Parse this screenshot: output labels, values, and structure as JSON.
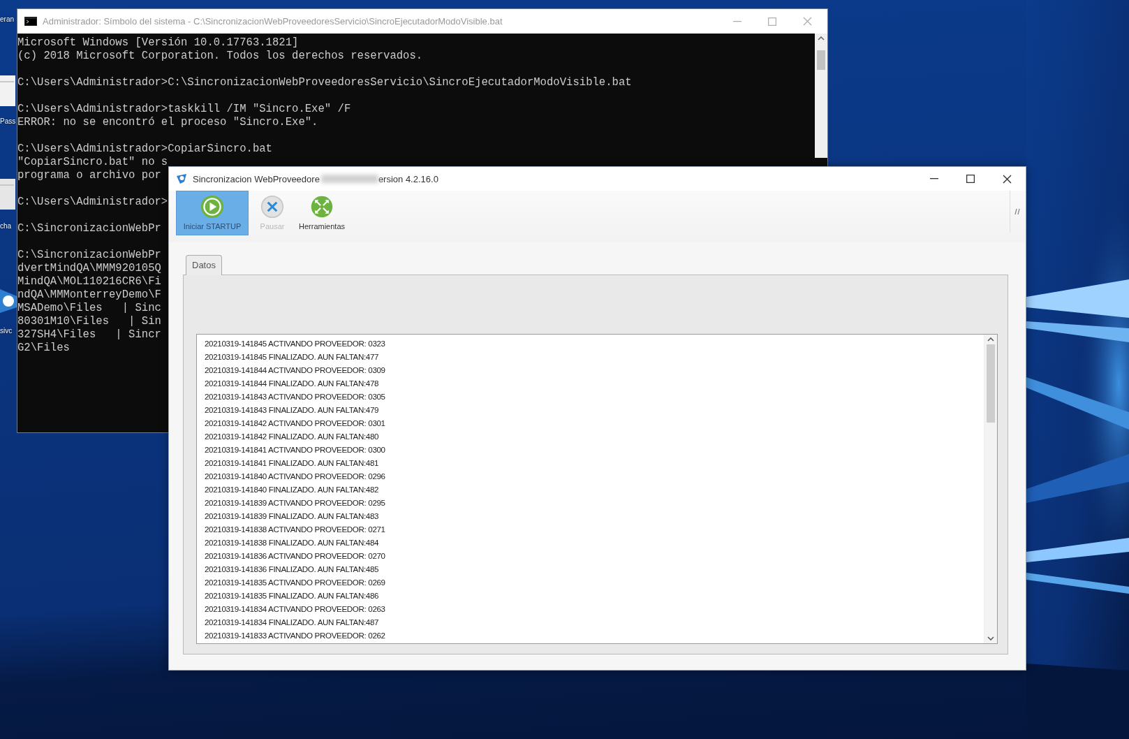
{
  "desktop": {
    "icon_labels": [
      "eran",
      "Pass",
      "cha",
      "sivc"
    ]
  },
  "console": {
    "title": "Administrador: Símbolo del sistema - C:\\SincronizacionWebProveedoresServicio\\SincroEjecutadorModoVisible.bat",
    "blocks": [
      [
        "Microsoft Windows [Versión 10.0.17763.1821]",
        "(c) 2018 Microsoft Corporation. Todos los derechos reservados."
      ],
      [
        "C:\\Users\\Administrador>C:\\SincronizacionWebProveedoresServicio\\SincroEjecutadorModoVisible.bat"
      ],
      [
        "C:\\Users\\Administrador>taskkill /IM \"Sincro.Exe\" /F",
        "ERROR: no se encontró el proceso \"Sincro.Exe\"."
      ],
      [
        "C:\\Users\\Administrador>CopiarSincro.bat",
        "\"CopiarSincro.bat\" no s",
        "programa o archivo por"
      ],
      [
        "C:\\Users\\Administrador>"
      ],
      [
        "C:\\SincronizacionWebPr"
      ],
      [
        "C:\\SincronizacionWebPr",
        "dvertMindQA\\MMM920105Q",
        "MindQA\\MOL110216CR6\\Fi",
        "ndQA\\MMMonterreyDemo\\F",
        "MSADemo\\Files   | Sinc",
        "80301M10\\Files   | Sin",
        "327SH4\\Files   | Sincr",
        "G2\\Files"
      ]
    ]
  },
  "app": {
    "title_start": "Sincronizacion WebProveedore",
    "title_end": "ersion 4.2.16.0",
    "toolbar": [
      {
        "label": "Iniciar STARTUP",
        "kind": "play",
        "selected": true,
        "disabled": false
      },
      {
        "label": "Pausar",
        "kind": "stop",
        "selected": false,
        "disabled": true
      },
      {
        "label": "Herramientas",
        "kind": "tools",
        "selected": false,
        "disabled": false
      }
    ],
    "tabs": [
      {
        "label": "Datos",
        "selected": true
      }
    ],
    "log": [
      "20210319-141845 ACTIVANDO PROVEEDOR: 0323",
      "20210319-141845 FINALIZADO. AUN FALTAN:477",
      "20210319-141844 ACTIVANDO PROVEEDOR: 0309",
      "20210319-141844 FINALIZADO. AUN FALTAN:478",
      "20210319-141843 ACTIVANDO PROVEEDOR: 0305",
      "20210319-141843 FINALIZADO. AUN FALTAN:479",
      "20210319-141842 ACTIVANDO PROVEEDOR: 0301",
      "20210319-141842 FINALIZADO. AUN FALTAN:480",
      "20210319-141841 ACTIVANDO PROVEEDOR: 0300",
      "20210319-141841 FINALIZADO. AUN FALTAN:481",
      "20210319-141840 ACTIVANDO PROVEEDOR: 0296",
      "20210319-141840 FINALIZADO. AUN FALTAN:482",
      "20210319-141839 ACTIVANDO PROVEEDOR: 0295",
      "20210319-141839 FINALIZADO. AUN FALTAN:483",
      "20210319-141838 ACTIVANDO PROVEEDOR: 0271",
      "20210319-141838 FINALIZADO. AUN FALTAN:484",
      "20210319-141836 ACTIVANDO PROVEEDOR: 0270",
      "20210319-141836 FINALIZADO. AUN FALTAN:485",
      "20210319-141835 ACTIVANDO PROVEEDOR: 0269",
      "20210319-141835 FINALIZADO. AUN FALTAN:486",
      "20210319-141834 ACTIVANDO PROVEEDOR: 0263",
      "20210319-141834 FINALIZADO. AUN FALTAN:487",
      "20210319-141833 ACTIVANDO PROVEEDOR: 0262"
    ]
  }
}
